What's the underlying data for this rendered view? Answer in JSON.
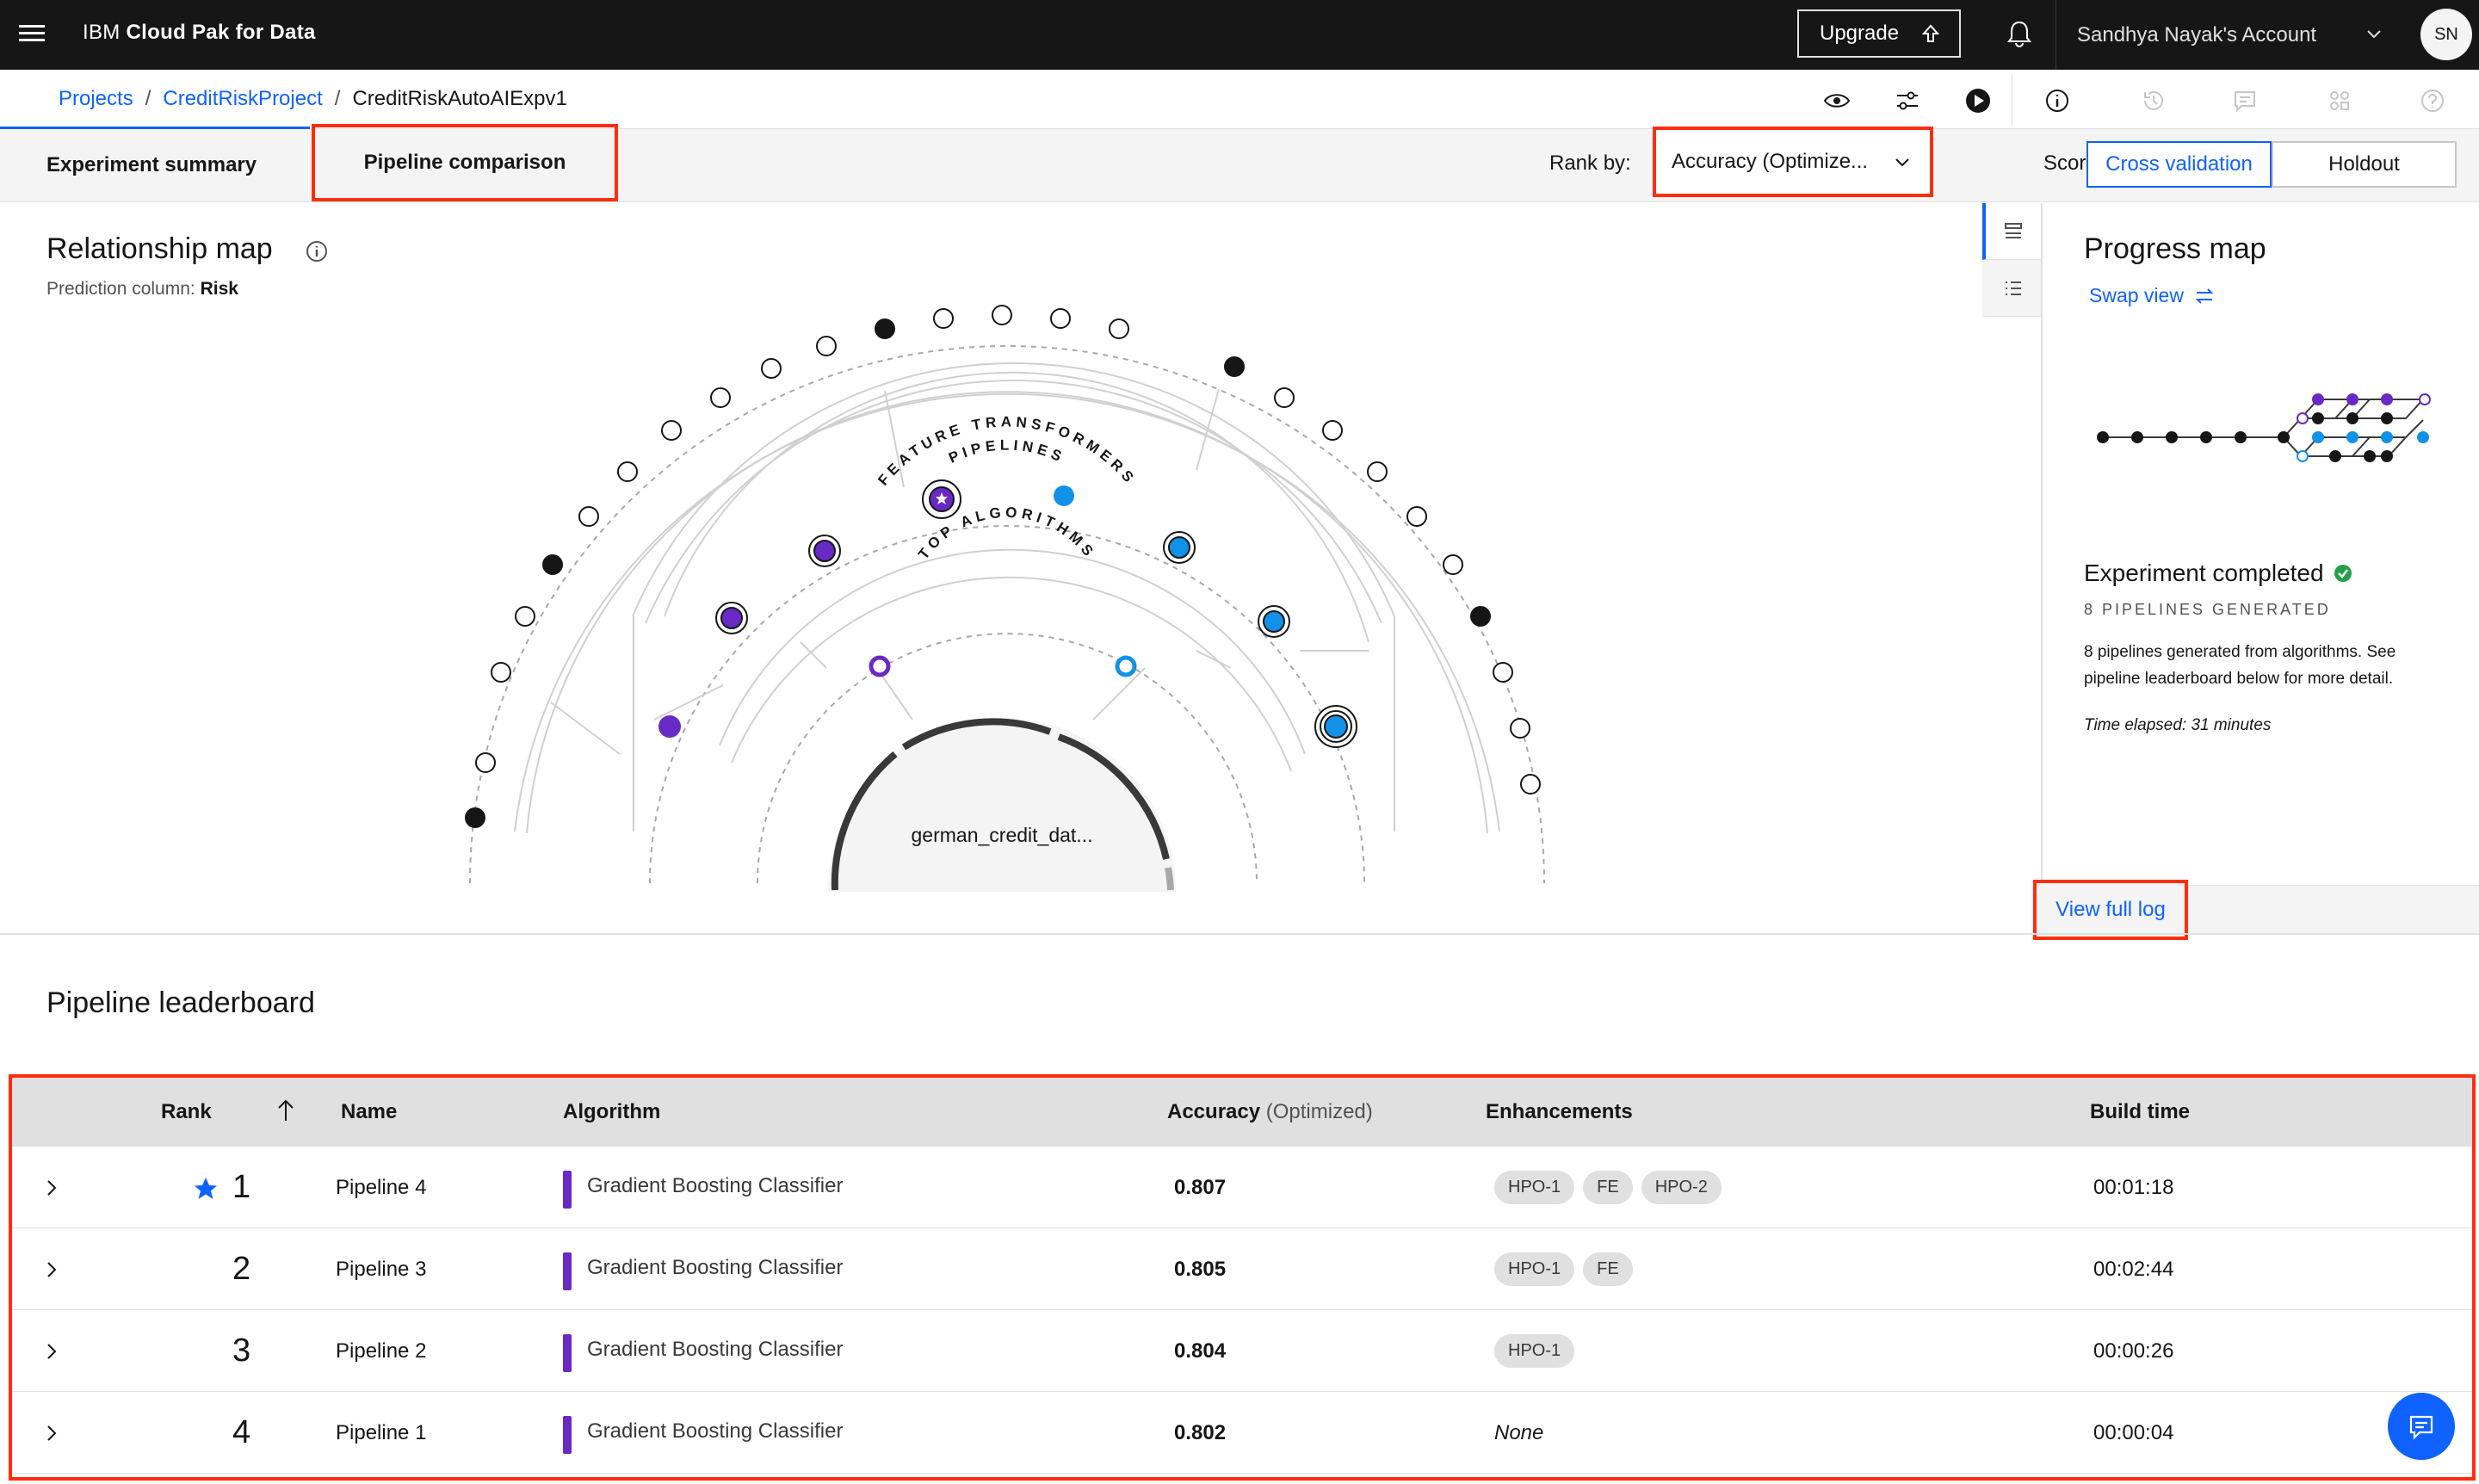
{
  "header": {
    "brand_light": "IBM ",
    "brand_bold": "Cloud Pak for Data",
    "upgrade_label": "Upgrade",
    "account_label": "Sandhya Nayak's Account",
    "avatar_initials": "SN"
  },
  "breadcrumb": {
    "items": [
      "Projects",
      "CreditRiskProject"
    ],
    "current": "CreditRiskAutoAIExpv1"
  },
  "tabs": {
    "experiment_summary": "Experiment summary",
    "pipeline_comparison": "Pipeline comparison"
  },
  "rank_by": {
    "label": "Rank by:",
    "value": "Accuracy (Optimize..."
  },
  "score": {
    "label": "Score:",
    "options": [
      "Cross validation",
      "Holdout"
    ],
    "selected": "Cross validation"
  },
  "relationship_map": {
    "title": "Relationship map",
    "prediction_label": "Prediction column:",
    "prediction_value": "Risk",
    "ring_feature_transformers": "FEATURE TRANSFORMERS",
    "ring_pipelines": "PIPELINES",
    "ring_top_algorithms": "TOP ALGORITHMS",
    "dataset": "german_credit_dat..."
  },
  "progress_map": {
    "title": "Progress map",
    "swap_view": "Swap view",
    "status": "Experiment completed",
    "pipelines_generated": "8 PIPELINES GENERATED",
    "description": "8 pipelines generated from algorithms. See pipeline leaderboard below for more detail.",
    "time_elapsed": "Time elapsed: 31 minutes",
    "view_full_log": "View full log"
  },
  "leaderboard": {
    "title": "Pipeline leaderboard",
    "columns": {
      "rank": "Rank",
      "name": "Name",
      "algorithm": "Algorithm",
      "accuracy": "Accuracy",
      "accuracy_note": "(Optimized)",
      "enhancements": "Enhancements",
      "build_time": "Build time"
    },
    "rows": [
      {
        "rank": "1",
        "name": "Pipeline 4",
        "algorithm": "Gradient Boosting Classifier",
        "accuracy": "0.807",
        "enhancements": [
          "HPO-1",
          "FE",
          "HPO-2"
        ],
        "build_time": "00:01:18"
      },
      {
        "rank": "2",
        "name": "Pipeline 3",
        "algorithm": "Gradient Boosting Classifier",
        "accuracy": "0.805",
        "enhancements": [
          "HPO-1",
          "FE"
        ],
        "build_time": "00:02:44"
      },
      {
        "rank": "3",
        "name": "Pipeline 2",
        "algorithm": "Gradient Boosting Classifier",
        "accuracy": "0.804",
        "enhancements": [
          "HPO-1"
        ],
        "build_time": "00:00:26"
      },
      {
        "rank": "4",
        "name": "Pipeline 1",
        "algorithm": "Gradient Boosting Classifier",
        "accuracy": "0.802",
        "enhancements": [],
        "enhancements_none": "None",
        "build_time": "00:00:04"
      }
    ]
  },
  "colors": {
    "accent": "#0f62fe",
    "purple": "#6929c4",
    "cyan": "#1192e8",
    "highlight": "#ff2d10",
    "success": "#24a148"
  }
}
